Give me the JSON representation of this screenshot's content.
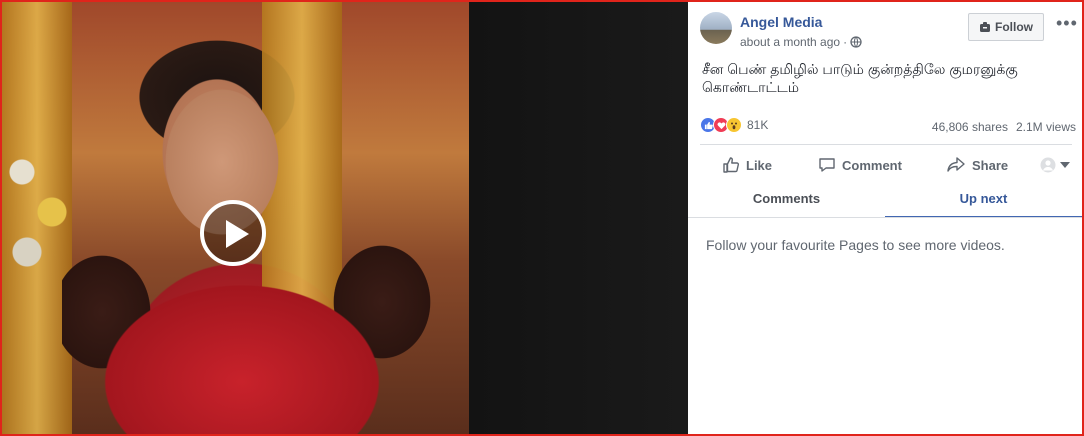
{
  "post": {
    "page_name": "Angel Media",
    "timestamp": "about a month ago",
    "separator": "·",
    "audience_icon": "globe-icon",
    "follow_label": "Follow",
    "more_label": "•••",
    "caption": "சீன பெண் தமிழில் பாடும் குன்றத்திலே குமரனுக்கு கொண்டாட்டம்"
  },
  "video": {
    "play_icon": "play-icon"
  },
  "engagement": {
    "reaction_icons": [
      "like-reaction-icon",
      "love-reaction-icon",
      "wow-reaction-icon"
    ],
    "reaction_count": "81K",
    "shares": "46,806 shares",
    "views": "2.1M views"
  },
  "actions": {
    "like": "Like",
    "comment": "Comment",
    "share": "Share"
  },
  "tabs": {
    "comments": "Comments",
    "up_next": "Up next",
    "active": "up_next"
  },
  "up_next": {
    "empty_message": "Follow your favourite Pages to see more videos."
  },
  "colors": {
    "link_blue": "#365899",
    "active_tab_underline": "#4267b2",
    "frame_border": "#e0241b",
    "secondary_text": "#606770"
  }
}
